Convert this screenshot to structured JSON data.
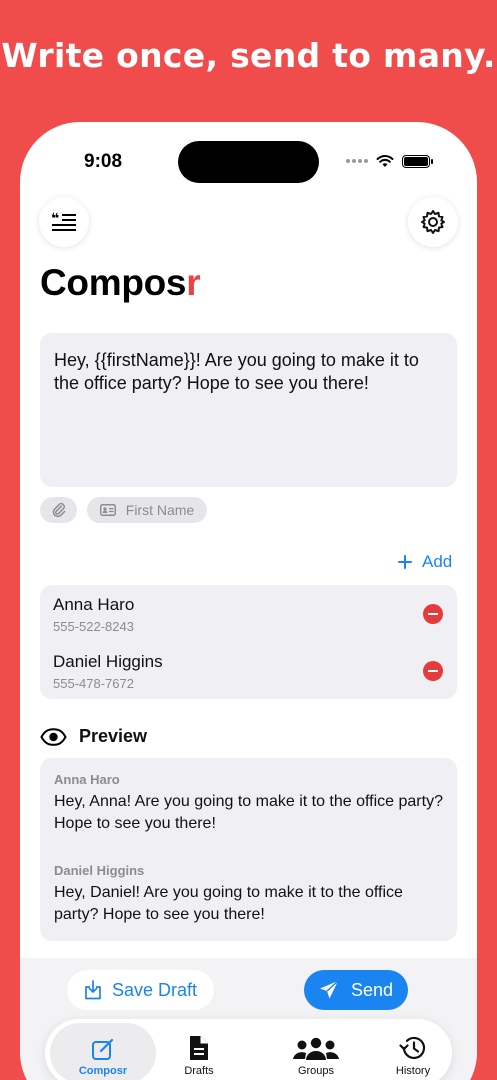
{
  "headline": "Write once, send to many.",
  "status": {
    "time": "9:08"
  },
  "app": {
    "title_main": "Compos",
    "title_accent": "r",
    "accent_color": "#E94343",
    "brand_color": "#1A84F0"
  },
  "toolbar": {
    "left_icon": "quote-list-icon",
    "right_icon": "gear-icon"
  },
  "editor": {
    "text": "Hey, {{firstName}}! Are you going to make it to the office party? Hope to see you there!"
  },
  "chips": {
    "attachment_icon": "paperclip-icon",
    "first_name_label": "First Name"
  },
  "recipients": {
    "add_label": "Add",
    "items": [
      {
        "name": "Anna Haro",
        "phone": "555-522-8243"
      },
      {
        "name": "Daniel Higgins",
        "phone": "555-478-7672"
      }
    ]
  },
  "preview": {
    "heading": "Preview",
    "items": [
      {
        "name": "Anna Haro",
        "text": "Hey, Anna! Are you going to make it to the office party? Hope to see you there!"
      },
      {
        "name": "Daniel Higgins",
        "text": "Hey, Daniel! Are you going to make it to the office party? Hope to see you there!"
      }
    ]
  },
  "actions": {
    "save_draft": "Save Draft",
    "send": "Send"
  },
  "tabs": [
    {
      "label": "Composr",
      "icon": "compose-icon",
      "active": true
    },
    {
      "label": "Drafts",
      "icon": "document-icon",
      "active": false
    },
    {
      "label": "Groups",
      "icon": "people-icon",
      "active": false
    },
    {
      "label": "History",
      "icon": "history-icon",
      "active": false
    }
  ]
}
